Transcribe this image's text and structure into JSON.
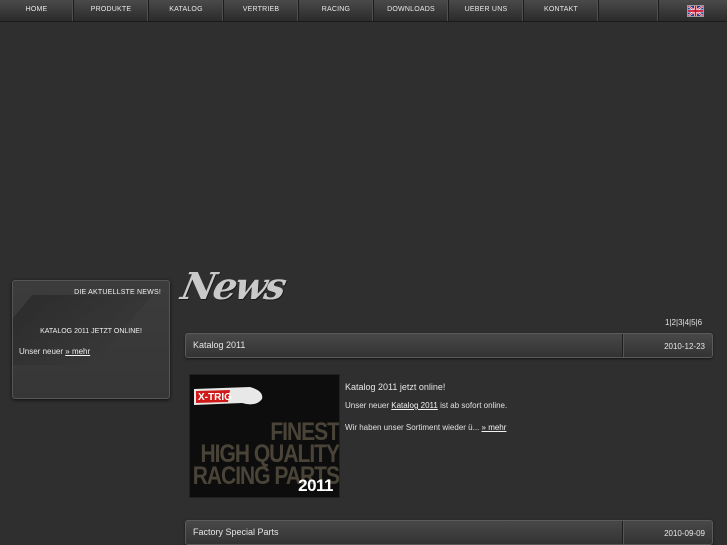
{
  "nav": {
    "items": [
      {
        "label": "HOME"
      },
      {
        "label": "PRODUKTE"
      },
      {
        "label": "KATALOG"
      },
      {
        "label": "VERTRIEB"
      },
      {
        "label": "RACING"
      },
      {
        "label": "DOWNLOADS"
      },
      {
        "label": "UEBER UNS"
      },
      {
        "label": "KONTAKT"
      }
    ],
    "language_icon": "uk-flag-icon"
  },
  "sidebar": {
    "header": "DIE AKTUELLSTE NEWS!",
    "news_title": "KATALOG 2011 JETZT ONLINE!",
    "news_text": "Unser neuer",
    "more_link": "» mehr"
  },
  "main": {
    "heading": "News",
    "pager": [
      "1",
      "2",
      "3",
      "4",
      "5",
      "6"
    ],
    "pager_sep": "|",
    "articles": [
      {
        "title": "Katalog 2011",
        "date": "2010-12-23"
      },
      {
        "title": "Factory Special Parts",
        "date": "2010-09-09"
      }
    ],
    "featured": {
      "lead": "Katalog 2011 jetzt online!",
      "p1_pre": "Unser neuer",
      "p1_link": "Katalog 2011",
      "p1_post": "ist ab sofort online.",
      "p2_pre": "Wir haben unser Sortiment wieder ü...",
      "p2_link": "» mehr",
      "image": {
        "brand": "X-TRIG",
        "line1": "FINEST",
        "line2": "HIGH QUALITY",
        "line3": "RACING PARTS",
        "year": "2011"
      }
    }
  }
}
